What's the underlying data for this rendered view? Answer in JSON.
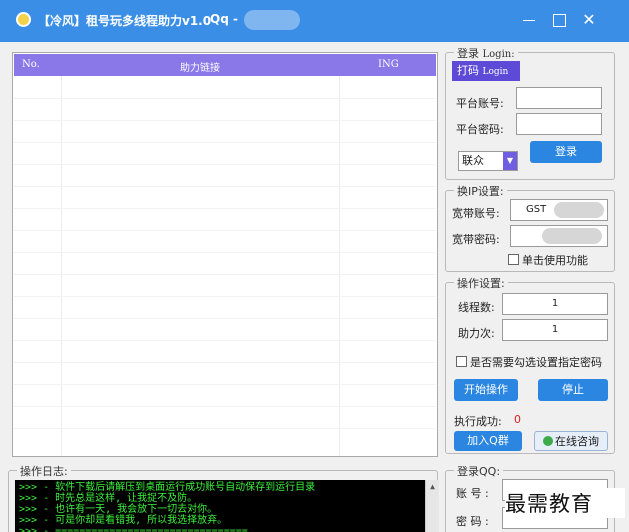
{
  "window": {
    "title": "【冷风】租号玩多线程助力v1.0",
    "qq_label": "Qq -",
    "icon": "app-logo-icon",
    "controls": {
      "minimize": "minimize-icon",
      "maximize": "maximize-icon",
      "close": "close-icon"
    }
  },
  "grid": {
    "columns": {
      "no": "No.",
      "link": "助力链接",
      "ing": "ING"
    }
  },
  "login": {
    "group_title": "登录",
    "group_title_en": "Login:",
    "tab_label": "打码",
    "tab_label_en": "Login",
    "account_label": "平台账号:",
    "password_label": "平台密码:",
    "account_value": "",
    "password_value": "",
    "provider_selected": "联众",
    "login_button": "登录"
  },
  "ip": {
    "group_title": "换IP设置:",
    "account_label": "宽带账号:",
    "password_label": "宽带密码:",
    "account_value": "GST",
    "password_value": "",
    "single_use_label": "单击使用功能"
  },
  "ops": {
    "group_title": "操作设置:",
    "threads_label": "线程数:",
    "threads_value": "1",
    "assist_label": "助力次:",
    "assist_value": "1",
    "custom_pwd_label": "是否需要勾选设置指定密码",
    "start_button": "开始操作",
    "stop_button": "停止",
    "success_label": "执行成功:",
    "success_count": "0",
    "join_qq_group_button": "加入Q群",
    "online_consult_button": "在线咨询"
  },
  "log": {
    "group_title": "操作日志:",
    "lines": [
      ">>> - 软件下载后请解压到桌面运行成功账号自动保存到运行目录",
      ">>> - 时先总是这样, 让我捉不及防。",
      ">>> - 也许有一天, 我会放下一切去对你。",
      ">>> - 可是你却是看错我, 所以我选择放弃。",
      ">>> - ================================"
    ]
  },
  "qq_login": {
    "group_title": "登录QQ:",
    "account_label": "账 号 :",
    "password_label": "密 码 :"
  },
  "watermark": "最需教育",
  "colors": {
    "titlebar": "#3a8ee6",
    "grid_header": "#8a78e8",
    "button": "#2a86e0",
    "console_bg": "#000000",
    "console_text": "#3ef23e",
    "success_count": "#e02020"
  }
}
